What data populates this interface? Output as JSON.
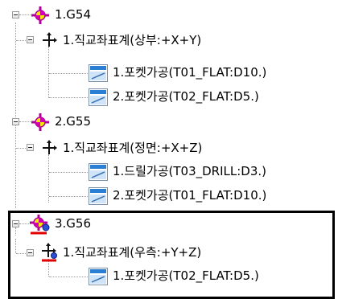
{
  "tree": {
    "nodes": [
      {
        "label": "1.G54",
        "icon": "origin-icon",
        "children": [
          {
            "label": "1.직교좌표계(상부:+X+Y)",
            "icon": "axis-icon",
            "children": [
              {
                "label": "1.포켓가공(T01_FLAT:D10.)",
                "icon": "operation-icon"
              },
              {
                "label": "2.포켓가공(T02_FLAT:D5.)",
                "icon": "operation-icon"
              }
            ]
          }
        ]
      },
      {
        "label": "2.G55",
        "icon": "origin-icon",
        "children": [
          {
            "label": "1.직교좌표계(정면:+X+Z)",
            "icon": "axis-icon",
            "children": [
              {
                "label": "1.드릴가공(T03_DRILL:D3.)",
                "icon": "operation-icon"
              },
              {
                "label": "2.포켓가공(T01_FLAT:D10.)",
                "icon": "operation-icon"
              }
            ]
          }
        ]
      },
      {
        "label": "3.G56",
        "icon": "origin-modified-icon",
        "children": [
          {
            "label": "1.직교좌표계(우측:+Y+Z)",
            "icon": "axis-modified-icon",
            "children": [
              {
                "label": "1.포켓가공(T02_FLAT:D5.)",
                "icon": "operation-icon"
              }
            ]
          }
        ]
      }
    ]
  },
  "colors": {
    "origin_fill": "#f5e800",
    "origin_cross": "#b0009a",
    "operation_blue": "#2a7fd4",
    "tree_line": "#9a9a9a",
    "highlight_border": "#000000",
    "modified_red": "#e00000"
  }
}
